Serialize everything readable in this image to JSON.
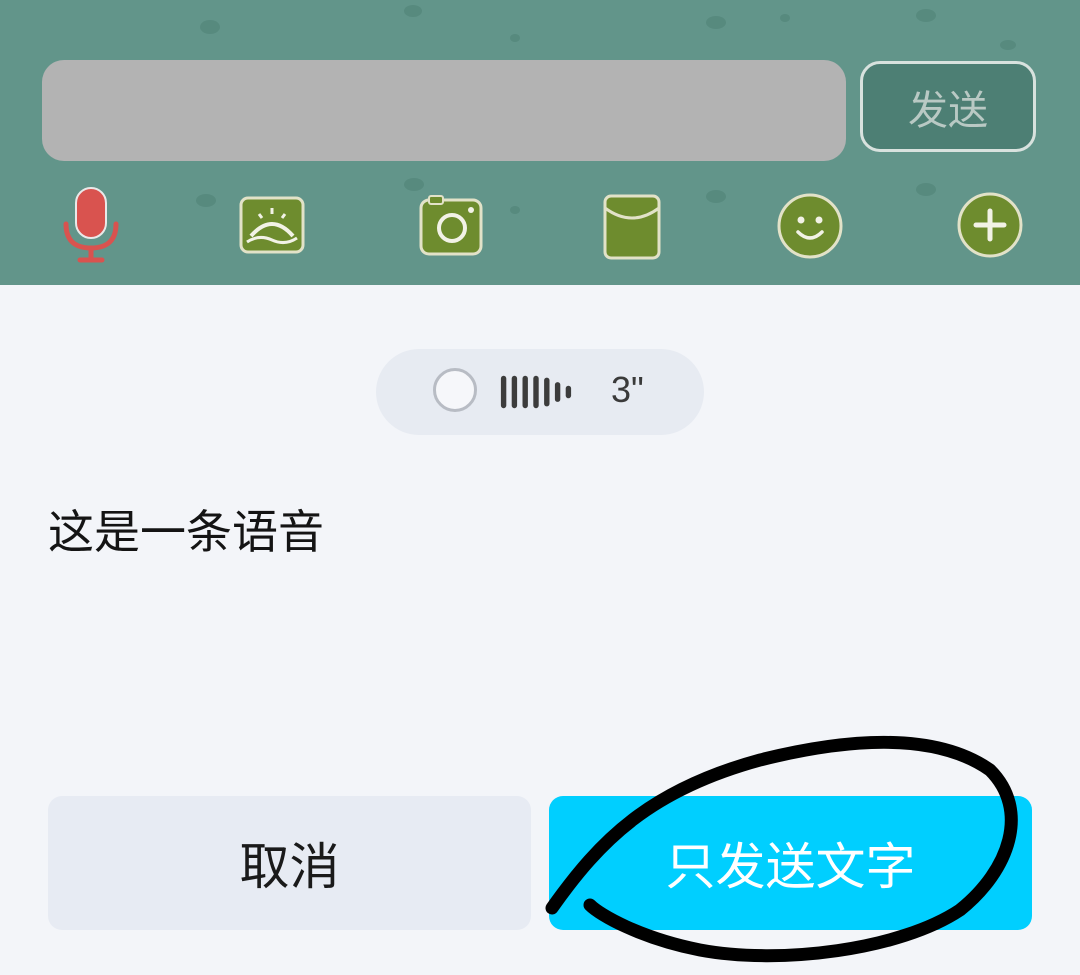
{
  "chat_bar": {
    "input_value": "",
    "send_label": "发送",
    "toolbar_icons": [
      "microphone-icon",
      "image-icon",
      "camera-icon",
      "red-envelope-icon",
      "emoji-icon",
      "plus-icon"
    ]
  },
  "voice_panel": {
    "duration": "3\"",
    "transcript": "这是一条语音",
    "cancel_label": "取消",
    "send_text_only_label": "只发送文字"
  },
  "colors": {
    "chat_bar_bg": "#62958a",
    "icon_green": "#6e8c2e",
    "mic_red": "#d9534f",
    "primary_button": "#00cfff",
    "secondary_button": "#e7ebf3",
    "panel_bg": "#f3f5f9",
    "annotation_ink": "#000000"
  }
}
